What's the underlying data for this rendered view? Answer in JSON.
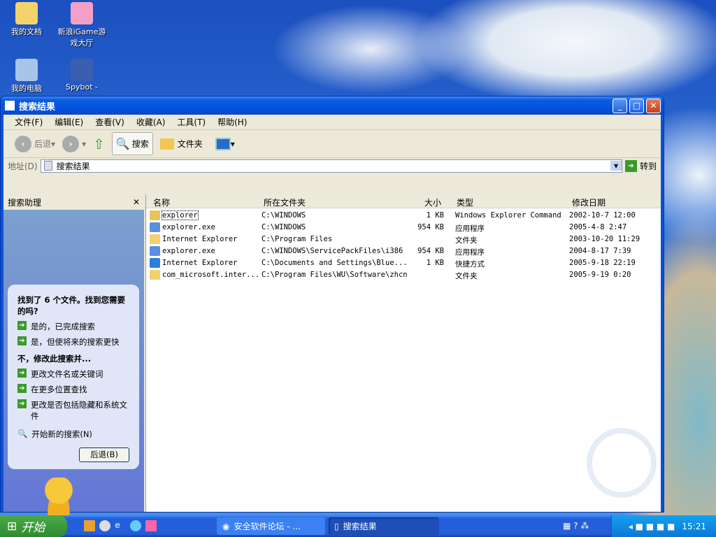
{
  "desktop": {
    "icons": [
      {
        "label": "我的文档"
      },
      {
        "label": "新浪iGame游戏大厅"
      },
      {
        "label": "我的电脑"
      },
      {
        "label": "Spybot -"
      }
    ]
  },
  "window": {
    "title": "搜索结果",
    "controls": {
      "minimize": "_",
      "maximize": "□",
      "close": "✕"
    }
  },
  "menu": [
    "文件(F)",
    "编辑(E)",
    "查看(V)",
    "收藏(A)",
    "工具(T)",
    "帮助(H)"
  ],
  "toolbar": {
    "back": "后退",
    "search": "搜索",
    "folders": "文件夹"
  },
  "address": {
    "label": "地址(D)",
    "value": "搜索结果",
    "go": "转到"
  },
  "pane": {
    "title": "搜索助理",
    "close": "✕",
    "question": "找到了 6 个文件。找到您需要的吗?",
    "yes_items": [
      "是的，已完成搜索",
      "是，但使将来的搜索更快"
    ],
    "modify_heading": "不，修改此搜索并...",
    "modify_items": [
      "更改文件名或关键词",
      "在更多位置查找",
      "更改是否包括隐藏和系统文件"
    ],
    "new_search": "开始新的搜索(N)",
    "back_button": "后退(B)"
  },
  "columns": [
    "名称",
    "所在文件夹",
    "大小",
    "类型",
    "修改日期"
  ],
  "rows": [
    {
      "name": "explorer",
      "folder": "C:\\WINDOWS",
      "size": "1 KB",
      "type": "Windows Explorer Command",
      "date": "2002-10-7 12:00",
      "icon": "#e8c25a"
    },
    {
      "name": "explorer.exe",
      "folder": "C:\\WINDOWS",
      "size": "954 KB",
      "type": "应用程序",
      "date": "2005-4-8 2:47",
      "icon": "#5c8fe0"
    },
    {
      "name": "Internet Explorer",
      "folder": "C:\\Program Files",
      "size": "",
      "type": "文件夹",
      "date": "2003-10-20 11:29",
      "icon": "#f0d070"
    },
    {
      "name": "explorer.exe",
      "folder": "C:\\WINDOWS\\ServicePackFiles\\i386",
      "size": "954 KB",
      "type": "应用程序",
      "date": "2004-8-17 7:39",
      "icon": "#5c8fe0"
    },
    {
      "name": "Internet Explorer",
      "folder": "C:\\Documents and Settings\\Blue...",
      "size": "1 KB",
      "type": "快捷方式",
      "date": "2005-9-18 22:19",
      "icon": "#2a7fe0"
    },
    {
      "name": "com_microsoft.inter...",
      "folder": "C:\\Program Files\\WU\\Software\\zhcn",
      "size": "",
      "type": "文件夹",
      "date": "2005-9-19 0:20",
      "icon": "#f0d070"
    }
  ],
  "taskbar": {
    "start": "开始",
    "tasks": [
      "安全软件论坛 - ...",
      "搜索结果"
    ],
    "clock": "15:21"
  }
}
